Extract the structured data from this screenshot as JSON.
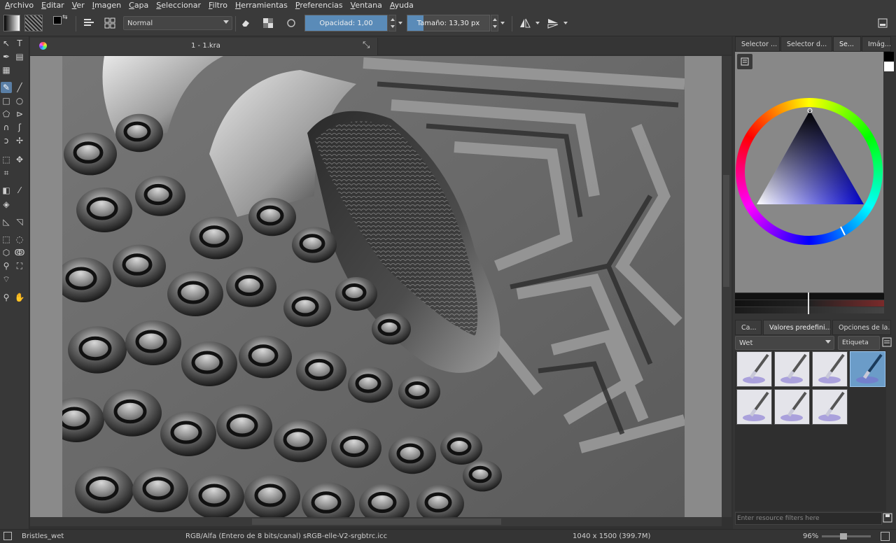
{
  "menu": [
    "Archivo",
    "Editar",
    "Ver",
    "Imagen",
    "Capa",
    "Seleccionar",
    "Filtro",
    "Herramientas",
    "Preferencias",
    "Ventana",
    "Ayuda"
  ],
  "toolbar": {
    "blend_mode": "Normal",
    "opacity_label": "Opacidad:",
    "opacity_value": "1,00",
    "opacity_fraction": 1.0,
    "size_label": "Tamaño:",
    "size_value": "13,30 px",
    "size_fraction": 0.2
  },
  "document": {
    "tab_title": "1 - 1.kra"
  },
  "dock": {
    "top_tabs": [
      "Selector ...",
      "Selector d...",
      "Se...",
      "Imág..."
    ],
    "bottom_tabs": [
      "Ca...",
      "Valores predefini...",
      "Opciones de la..."
    ],
    "brush_tag": "Wet",
    "tag_button": "Etiqueta",
    "filter_placeholder": "Enter resource filters here"
  },
  "colors": {
    "accent": "#5a8bb8",
    "foreground": "#000000",
    "background": "#ffffff",
    "selected_hue": "#0000cc"
  },
  "status": {
    "brush": "Bristles_wet",
    "colorspace": "RGB/Alfa (Entero de 8 bits/canal)  sRGB-elle-V2-srgbtrc.icc",
    "dimensions": "1040 x 1500 (399.7M)",
    "zoom": "96%"
  },
  "icons": [
    "cursor-icon",
    "text-icon",
    "brush-icon",
    "line-icon",
    "rectangle-icon",
    "ellipse-icon",
    "polygon-icon",
    "polyline-icon",
    "bezier-icon",
    "freehand-path-icon",
    "dynamic-brush-icon",
    "multibrush-icon",
    "transform-icon",
    "move-icon",
    "crop-icon",
    "gradient-icon",
    "color-picker-icon",
    "fill-icon",
    "assistant-icon",
    "measure-icon",
    "rect-select-icon",
    "ellipse-select-icon",
    "polygon-select-icon",
    "freehand-select-icon",
    "contiguous-select-icon",
    "similar-select-icon",
    "bezier-select-icon",
    "zoom-icon",
    "pan-icon"
  ]
}
